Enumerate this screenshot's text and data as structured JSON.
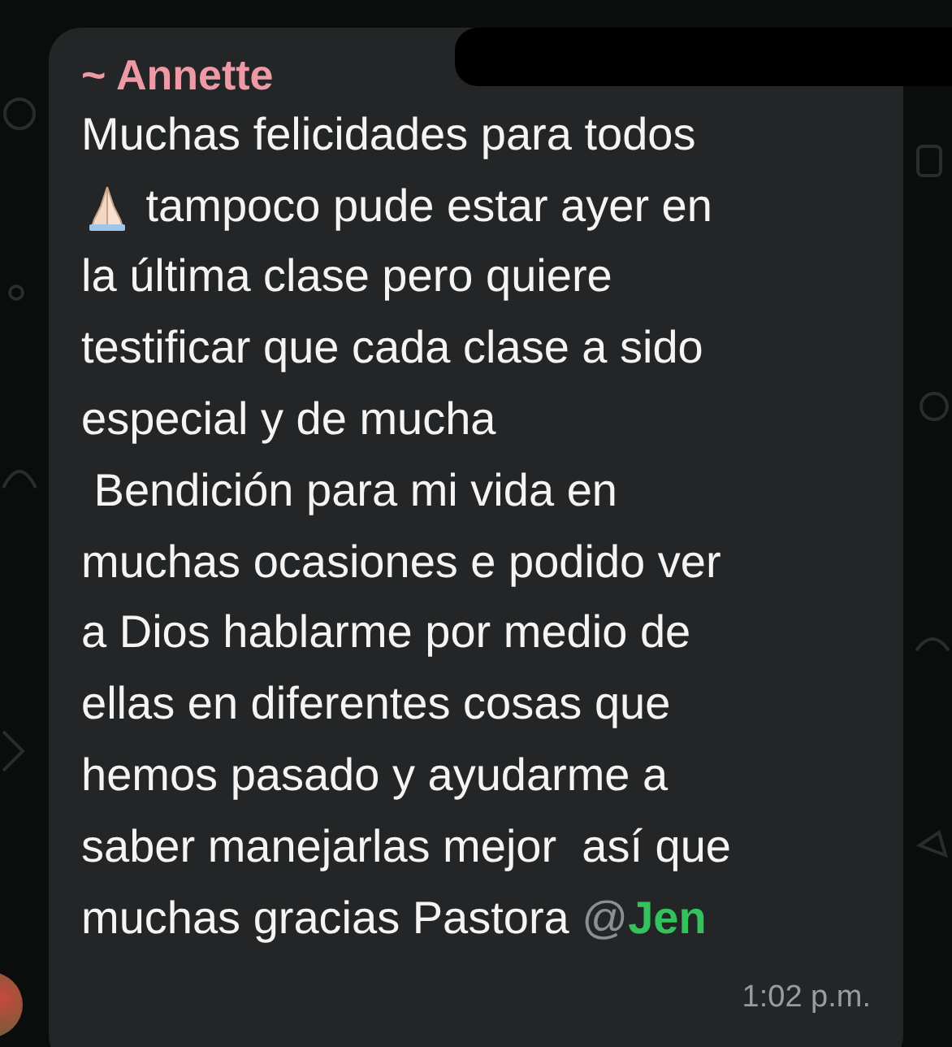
{
  "message": {
    "sender": "~ Annette",
    "lines": [
      {
        "kind": "text",
        "text": "Muchas felicidades para todos"
      },
      {
        "kind": "emoji",
        "text": " tampoco pude estar ayer en"
      },
      {
        "kind": "text",
        "text": "la última clase pero quiere"
      },
      {
        "kind": "text",
        "text": "testificar que cada clase a sido"
      },
      {
        "kind": "text",
        "text": "especial y de mucha"
      },
      {
        "kind": "text",
        "text": " Bendición para mi vida en"
      },
      {
        "kind": "text",
        "text": "muchas ocasiones e podido ver"
      },
      {
        "kind": "text",
        "text": "a Dios hablarme por medio de"
      },
      {
        "kind": "text",
        "text": "ellas en diferentes cosas que"
      },
      {
        "kind": "text",
        "text": "hemos pasado y ayudarme a"
      },
      {
        "kind": "text",
        "text": "saber manejarlas mejor  así que"
      },
      {
        "kind": "mention",
        "text": "muchas gracias Pastora ",
        "at": "@",
        "name": "Jen"
      }
    ],
    "time": "1:02 p.m."
  }
}
